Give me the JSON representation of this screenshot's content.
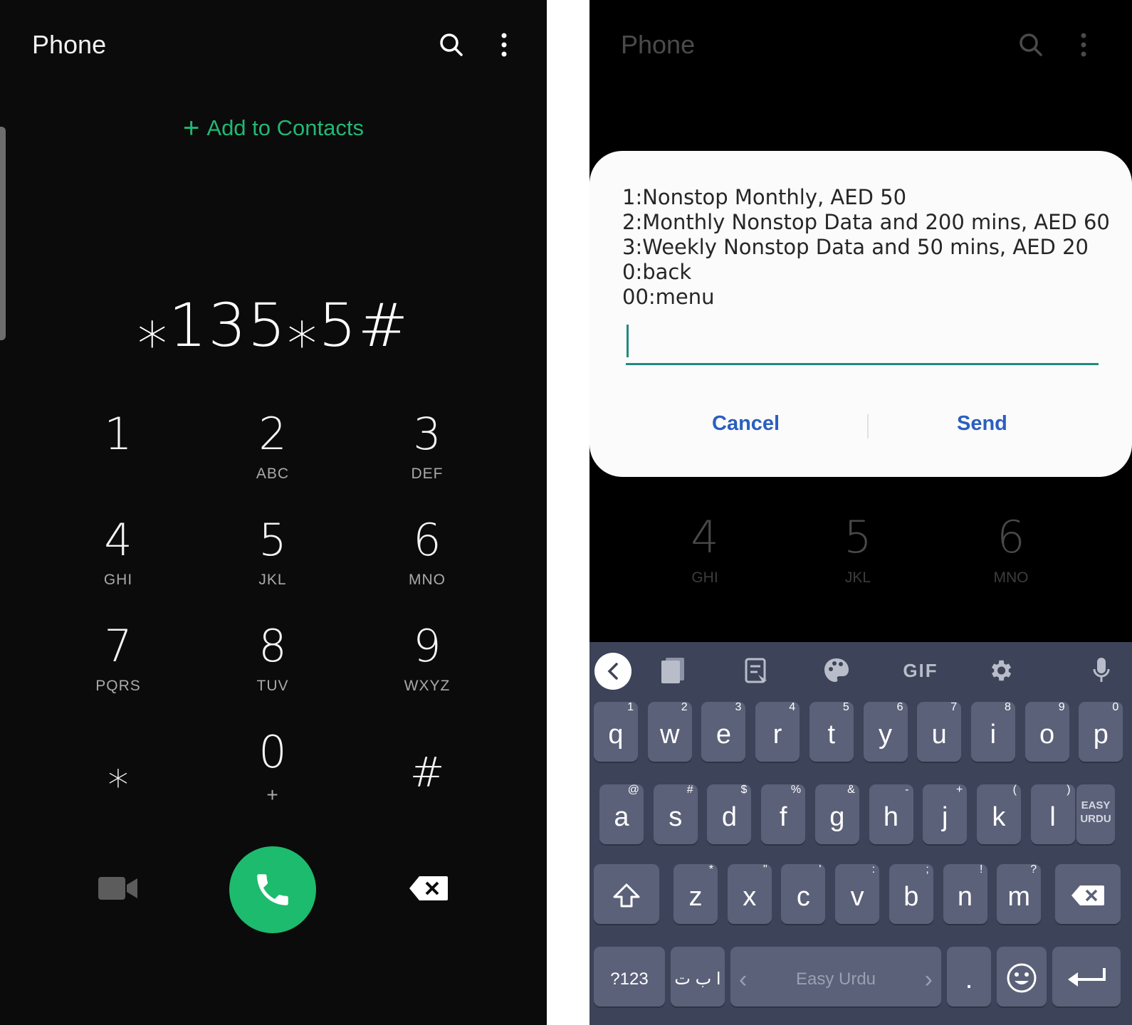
{
  "left": {
    "title": "Phone",
    "icons": {
      "search": "search-icon",
      "more": "more-vert-icon"
    },
    "add_contacts_label": "Add to Contacts",
    "dialed_number": "⁎135⁎5#",
    "keys": [
      {
        "digit": "1",
        "letters": ""
      },
      {
        "digit": "2",
        "letters": "ABC"
      },
      {
        "digit": "3",
        "letters": "DEF"
      },
      {
        "digit": "4",
        "letters": "GHI"
      },
      {
        "digit": "5",
        "letters": "JKL"
      },
      {
        "digit": "6",
        "letters": "MNO"
      },
      {
        "digit": "7",
        "letters": "PQRS"
      },
      {
        "digit": "8",
        "letters": "TUV"
      },
      {
        "digit": "9",
        "letters": "WXYZ"
      },
      {
        "digit": "⁎",
        "letters": ""
      },
      {
        "digit": "0",
        "letters": "+"
      },
      {
        "digit": "#",
        "letters": ""
      }
    ],
    "colors": {
      "accent": "#21b874",
      "call_button": "#1dbb6d",
      "background": "#0b0b0b"
    }
  },
  "right": {
    "title": "Phone",
    "dim_keys": [
      {
        "digit": "4",
        "letters": "GHI"
      },
      {
        "digit": "5",
        "letters": "JKL"
      },
      {
        "digit": "6",
        "letters": "MNO"
      }
    ],
    "dialog": {
      "lines": [
        "1:Nonstop Monthly, AED 50",
        "2:Monthly Nonstop Data and 200 mins, AED 60",
        "3:Weekly Nonstop Data and 50 mins, AED 20",
        "0:back",
        "00:menu"
      ],
      "input_value": "",
      "cancel_label": "Cancel",
      "send_label": "Send"
    },
    "keyboard": {
      "toolbar": [
        "back-arrow-icon",
        "urdu-dictionary-icon",
        "clipboard-icon",
        "theme-palette-icon",
        "GIF",
        "settings-gear-icon",
        "microphone-icon"
      ],
      "gif_label": "GIF",
      "row1": [
        {
          "k": "q",
          "h": "1"
        },
        {
          "k": "w",
          "h": "2"
        },
        {
          "k": "e",
          "h": "3"
        },
        {
          "k": "r",
          "h": "4"
        },
        {
          "k": "t",
          "h": "5"
        },
        {
          "k": "y",
          "h": "6"
        },
        {
          "k": "u",
          "h": "7"
        },
        {
          "k": "i",
          "h": "8"
        },
        {
          "k": "o",
          "h": "9"
        },
        {
          "k": "p",
          "h": "0"
        }
      ],
      "row2": [
        {
          "k": "a",
          "h": "@"
        },
        {
          "k": "s",
          "h": "#"
        },
        {
          "k": "d",
          "h": "$"
        },
        {
          "k": "f",
          "h": "%"
        },
        {
          "k": "g",
          "h": "&"
        },
        {
          "k": "h",
          "h": "-"
        },
        {
          "k": "j",
          "h": "+"
        },
        {
          "k": "k",
          "h": "("
        },
        {
          "k": "l",
          "h": ")"
        }
      ],
      "easy_urdu_key": "EASY URDU",
      "row3": [
        {
          "k": "z",
          "h": "*"
        },
        {
          "k": "x",
          "h": "\""
        },
        {
          "k": "c",
          "h": "'"
        },
        {
          "k": "v",
          "h": ":"
        },
        {
          "k": "b",
          "h": ";"
        },
        {
          "k": "n",
          "h": "!"
        },
        {
          "k": "m",
          "h": "?"
        }
      ],
      "symbols_key": "?123",
      "language_key": "ا ب ت",
      "space_label": "Easy Urdu",
      "period_key": ".",
      "colors": {
        "background": "#3d4358",
        "key": "#5b6178"
      }
    }
  }
}
